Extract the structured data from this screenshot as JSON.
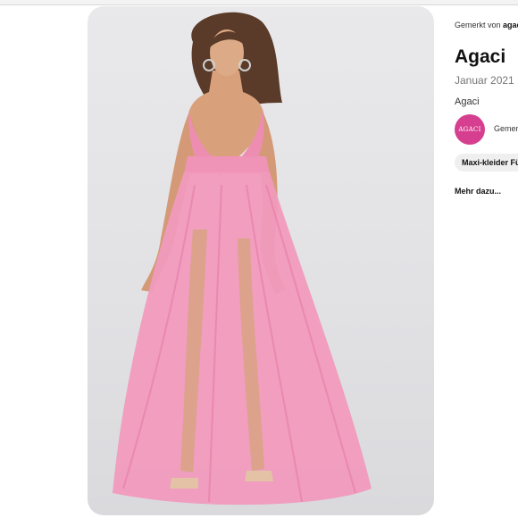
{
  "pin": {
    "image_alt": "Model wearing a long pink tulle maxi dress with high leg slits"
  },
  "sidebar": {
    "saved_prefix": "Gemerkt von",
    "saved_user": "agaci",
    "title": "Agaci",
    "date": "Januar 2021",
    "source_name": "Agaci",
    "avatar_text": "AGACI",
    "avatar_caption": "Gemerkt",
    "tag": "Maxi-kleider Fü",
    "more_link": "Mehr dazu..."
  },
  "colors": {
    "dress_pink": "#ef8fb4",
    "brand_avatar": "#d63f8f",
    "background_gray": "#e6e6e8"
  }
}
